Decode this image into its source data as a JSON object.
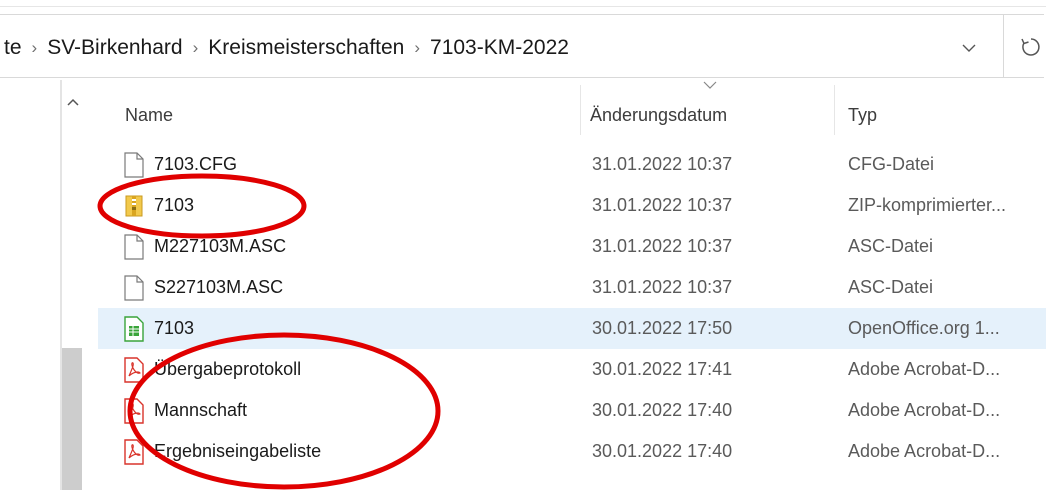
{
  "address": {
    "crumbs": [
      "te",
      "SV-Birkenhard",
      "Kreismeisterschaften",
      "7103-KM-2022"
    ]
  },
  "columns": {
    "name": "Name",
    "date": "Änderungsdatum",
    "type": "Typ"
  },
  "files": [
    {
      "name": "7103.CFG",
      "date": "31.01.2022 10:37",
      "type": "CFG-Datei",
      "icon": "generic-file-icon"
    },
    {
      "name": "7103",
      "date": "31.01.2022 10:37",
      "type": "ZIP-komprimierter...",
      "icon": "zip-folder-icon"
    },
    {
      "name": "M227103M.ASC",
      "date": "31.01.2022 10:37",
      "type": "ASC-Datei",
      "icon": "generic-file-icon"
    },
    {
      "name": "S227103M.ASC",
      "date": "31.01.2022 10:37",
      "type": "ASC-Datei",
      "icon": "generic-file-icon"
    },
    {
      "name": "7103",
      "date": "30.01.2022 17:50",
      "type": "OpenOffice.org 1...",
      "icon": "spreadsheet-icon",
      "selected": true
    },
    {
      "name": "Übergabeprotokoll",
      "date": "30.01.2022 17:41",
      "type": "Adobe Acrobat-D...",
      "icon": "pdf-icon"
    },
    {
      "name": "Mannschaft",
      "date": "30.01.2022 17:40",
      "type": "Adobe Acrobat-D...",
      "icon": "pdf-icon"
    },
    {
      "name": "Ergebniseingabeliste",
      "date": "30.01.2022 17:40",
      "type": "Adobe Acrobat-D...",
      "icon": "pdf-icon"
    }
  ],
  "colors": {
    "selection": "#e5f1fb",
    "annotation": "#e00000",
    "pdf": "#d9342b",
    "spreadsheet": "#3aa43a",
    "zip": "#e8b93a"
  },
  "icons": {
    "refresh": "refresh-icon",
    "dropdown": "chevron-down-icon",
    "scroll_up": "chevron-up-icon",
    "sort": "sort-chevron-icon"
  }
}
